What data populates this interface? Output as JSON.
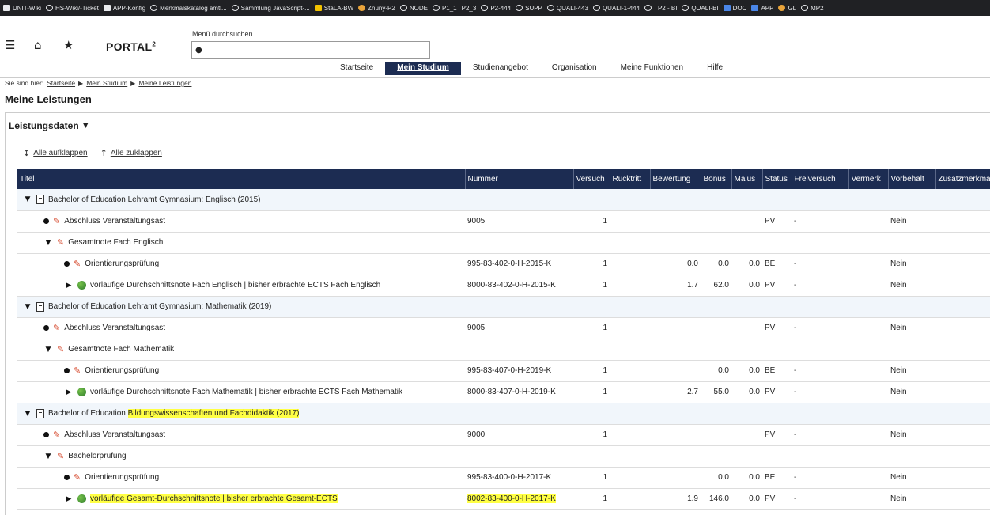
{
  "bookmarks": [
    {
      "label": "UNIT-Wiki",
      "icon": "square-icon"
    },
    {
      "label": "HS-Wiki/-Ticket",
      "icon": "globe-icon"
    },
    {
      "label": "APP-Konfig",
      "icon": "square-icon"
    },
    {
      "label": "Merkmalskatalog amtl...",
      "icon": "globe-icon"
    },
    {
      "label": "Sammlung JavaScript-...",
      "icon": "globe-icon"
    },
    {
      "label": "StaLA-BW",
      "icon": "folder-icon"
    },
    {
      "label": "Znuny-P2",
      "icon": "orange-icon"
    },
    {
      "label": "NODE",
      "icon": "globe-icon"
    },
    {
      "label": "P1_1",
      "icon": "globe-icon"
    },
    {
      "label": "P2_3",
      "icon": "none"
    },
    {
      "label": "P2-444",
      "icon": "globe-icon"
    },
    {
      "label": "SUPP",
      "icon": "globe-icon"
    },
    {
      "label": "QUALI-443",
      "icon": "globe-icon"
    },
    {
      "label": "QUALI-1-444",
      "icon": "globe-icon"
    },
    {
      "label": "TP2 - BI",
      "icon": "globe-icon"
    },
    {
      "label": "QUALI-BI",
      "icon": "globe-icon"
    },
    {
      "label": "DOC",
      "icon": "blue-icon"
    },
    {
      "label": "APP",
      "icon": "blue-icon"
    },
    {
      "label": "GL",
      "icon": "orange-icon"
    },
    {
      "label": "MP2",
      "icon": "globe-icon"
    }
  ],
  "header": {
    "logo": "PORTAL",
    "logo_sup": "2",
    "search_label": "Menü durchsuchen",
    "search_value": "",
    "nav": [
      "Startseite",
      "Mein Studium",
      "Studienangebot",
      "Organisation",
      "Meine Funktionen",
      "Hilfe"
    ],
    "nav_active": "Mein Studium"
  },
  "breadcrumb": {
    "prefix": "Sie sind hier:",
    "items": [
      "Startseite",
      "Mein Studium",
      "Meine Leistungen"
    ]
  },
  "page_title": "Meine Leistungen",
  "section": {
    "title": "Leistungsdaten",
    "expand_all": "Alle aufklappen",
    "collapse_all": "Alle zuklappen"
  },
  "table": {
    "columns": [
      "Titel",
      "Nummer",
      "Versuch",
      "Rücktritt",
      "Bewertung",
      "Bonus",
      "Malus",
      "Status",
      "Freiversuch",
      "Vermerk",
      "Vorbehalt",
      "Zusatzmerkmal"
    ],
    "rows": [
      {
        "level": 0,
        "type": "group",
        "toggle": "open",
        "icon": "document",
        "title": "Bachelor of Education Lehramt Gymnasium: Englisch (2015)"
      },
      {
        "level": 1,
        "type": "leaf",
        "icon": "tag",
        "title": "Abschluss Veranstaltungsast",
        "nummer": "9005",
        "versuch": "1",
        "bewertung": "",
        "bonus": "",
        "malus": "",
        "status": "PV",
        "freiversuch": "-",
        "vorbehalt": "Nein"
      },
      {
        "level": 1,
        "type": "node",
        "toggle": "open",
        "icon": "tag",
        "title": "Gesamtnote Fach Englisch"
      },
      {
        "level": 2,
        "type": "leaf",
        "icon": "tag",
        "title": "Orientierungsprüfung",
        "nummer": "995-83-402-0-H-2015-K",
        "versuch": "1",
        "bewertung": "0.0",
        "bonus": "0.0",
        "malus": "0.0",
        "status": "BE",
        "freiversuch": "-",
        "vorbehalt": "Nein"
      },
      {
        "level": 2,
        "type": "node",
        "toggle": "closed",
        "icon": "globe",
        "title": "vorläufige Durchschnittsnote Fach Englisch | bisher erbrachte ECTS Fach Englisch",
        "nummer": "8000-83-402-0-H-2015-K",
        "versuch": "1",
        "bewertung": "1.7",
        "bonus": "62.0",
        "malus": "0.0",
        "status": "PV",
        "freiversuch": "-",
        "vorbehalt": "Nein"
      },
      {
        "level": 0,
        "type": "group",
        "toggle": "open",
        "icon": "document",
        "title": "Bachelor of Education Lehramt Gymnasium: Mathematik (2019)"
      },
      {
        "level": 1,
        "type": "leaf",
        "icon": "tag",
        "title": "Abschluss Veranstaltungsast",
        "nummer": "9005",
        "versuch": "1",
        "bewertung": "",
        "bonus": "",
        "malus": "",
        "status": "PV",
        "freiversuch": "-",
        "vorbehalt": "Nein"
      },
      {
        "level": 1,
        "type": "node",
        "toggle": "open",
        "icon": "tag",
        "title": "Gesamtnote Fach Mathematik"
      },
      {
        "level": 2,
        "type": "leaf",
        "icon": "tag",
        "title": "Orientierungsprüfung",
        "nummer": "995-83-407-0-H-2019-K",
        "versuch": "1",
        "bewertung": "",
        "bonus": "0.0",
        "malus": "0.0",
        "status": "BE",
        "freiversuch": "-",
        "vorbehalt": "Nein"
      },
      {
        "level": 2,
        "type": "node",
        "toggle": "closed",
        "icon": "globe",
        "title": "vorläufige Durchschnittsnote Fach Mathematik | bisher erbrachte ECTS Fach Mathematik",
        "nummer": "8000-83-407-0-H-2019-K",
        "versuch": "1",
        "bewertung": "2.7",
        "bonus": "55.0",
        "malus": "0.0",
        "status": "PV",
        "freiversuch": "-",
        "vorbehalt": "Nein"
      },
      {
        "level": 0,
        "type": "group",
        "toggle": "open",
        "icon": "document",
        "title_plain": "Bachelor of Education ",
        "title_hl": "Bildungswissenschaften und Fachdidaktik (2017)"
      },
      {
        "level": 1,
        "type": "leaf",
        "icon": "tag",
        "title": "Abschluss Veranstaltungsast",
        "nummer": "9000",
        "versuch": "1",
        "bewertung": "",
        "bonus": "",
        "malus": "",
        "status": "PV",
        "freiversuch": "-",
        "vorbehalt": "Nein"
      },
      {
        "level": 1,
        "type": "node",
        "toggle": "open",
        "icon": "tag",
        "title": "Bachelorprüfung"
      },
      {
        "level": 2,
        "type": "leaf",
        "icon": "tag",
        "title": "Orientierungsprüfung",
        "nummer": "995-83-400-0-H-2017-K",
        "versuch": "1",
        "bewertung": "",
        "bonus": "0.0",
        "malus": "0.0",
        "status": "BE",
        "freiversuch": "-",
        "vorbehalt": "Nein"
      },
      {
        "level": 2,
        "type": "node",
        "toggle": "closed",
        "icon": "globe",
        "highlight": true,
        "title": "vorläufige Gesamt-Durchschnittsnote | bisher erbrachte Gesamt-ECTS",
        "nummer": "8002-83-400-0-H-2017-K",
        "versuch": "1",
        "bewertung": "1.9",
        "bonus": "146.0",
        "malus": "0.0",
        "status": "PV",
        "freiversuch": "-",
        "vorbehalt": "Nein"
      }
    ]
  },
  "colors": {
    "nav_active_bg": "#1c2c52",
    "table_header_bg": "#1c2c52",
    "group_row_bg": "#f1f6fb",
    "highlight": "#ffff44",
    "tag_icon": "#d6492d"
  }
}
